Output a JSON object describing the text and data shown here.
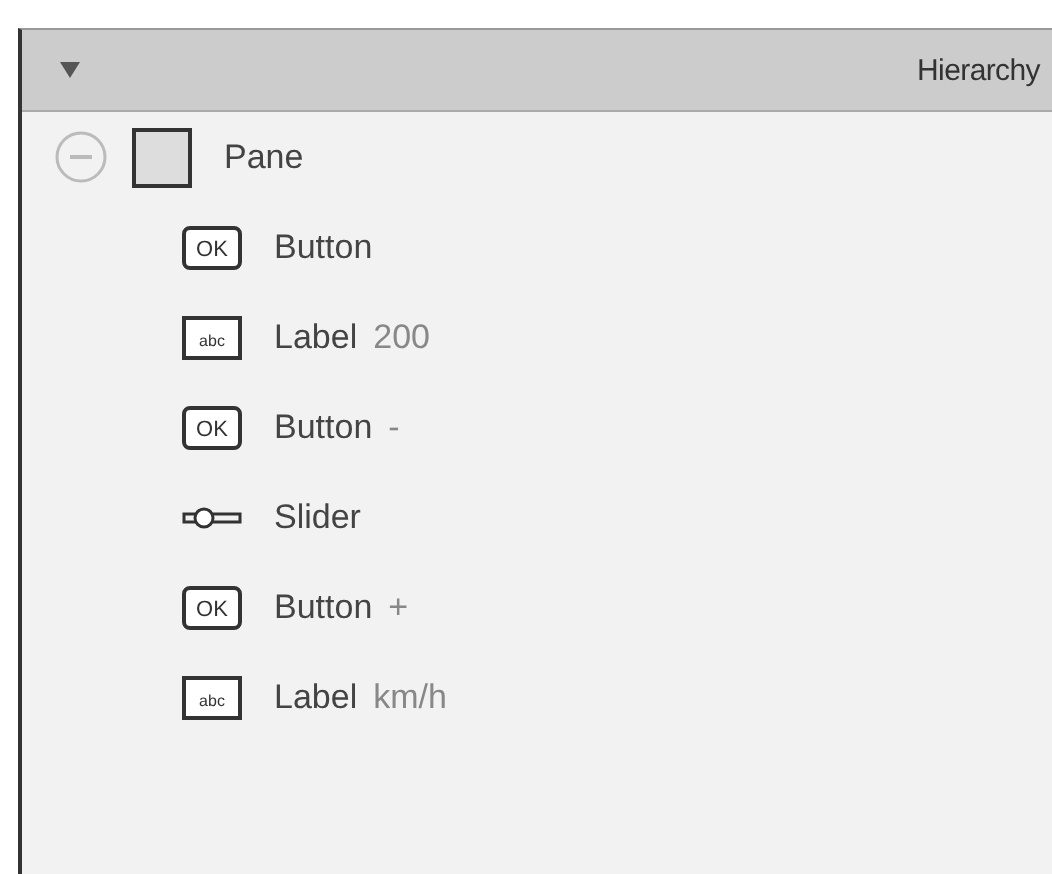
{
  "panel": {
    "title": "Hierarchy",
    "expanded": true
  },
  "tree": [
    {
      "kind": "pane",
      "label": "Pane",
      "expanded": true,
      "children": [
        {
          "kind": "button",
          "icon_text": "OK",
          "label": "Button"
        },
        {
          "kind": "label",
          "icon_text": "abc",
          "label": "Label",
          "text": "200"
        },
        {
          "kind": "button",
          "icon_text": "OK",
          "label": "Button",
          "text": "-"
        },
        {
          "kind": "slider",
          "label": "Slider"
        },
        {
          "kind": "button",
          "icon_text": "OK",
          "label": "Button",
          "text": "+"
        },
        {
          "kind": "label",
          "icon_text": "abc",
          "label": "Label",
          "text": "km/h"
        }
      ]
    }
  ]
}
